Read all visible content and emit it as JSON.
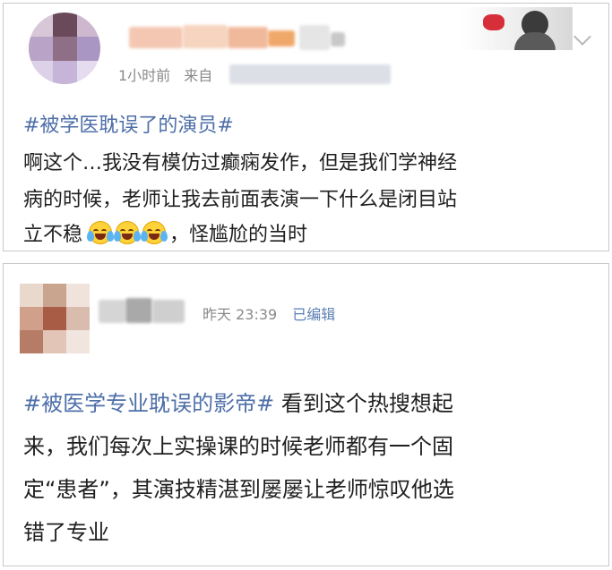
{
  "post1": {
    "time": "1小时前",
    "source_prefix": "来自",
    "hashtag": "#被学医耽误了的演员#",
    "line1": "啊这个…我没有模仿过癫痫发作，但是我们学神经",
    "line2": "病的时候，老师让我去前面表演一下什么是闭目站",
    "line3_pre": "立不稳",
    "line3_post": "，怪尴尬的当时",
    "emoji_icon": "laugh-cry-icon",
    "menu_icon": "chevron-down-icon"
  },
  "post2": {
    "time": "昨天 23:39",
    "edited": "已编辑",
    "hashtag": "#被医学专业耽误的影帝#",
    "line1_rest": " 看到这个热搜想起",
    "line2": "来，我们每次上实操课的时候老师都有一个固",
    "line3": "定“患者”，其演技精湛到屡屡让老师惊叹他选",
    "line4": "错了专业"
  },
  "colors": {
    "hashtag": "#4e6fa8",
    "meta": "#8a8a8a",
    "edited": "#5b7fb5",
    "text": "#1f1f1f"
  }
}
